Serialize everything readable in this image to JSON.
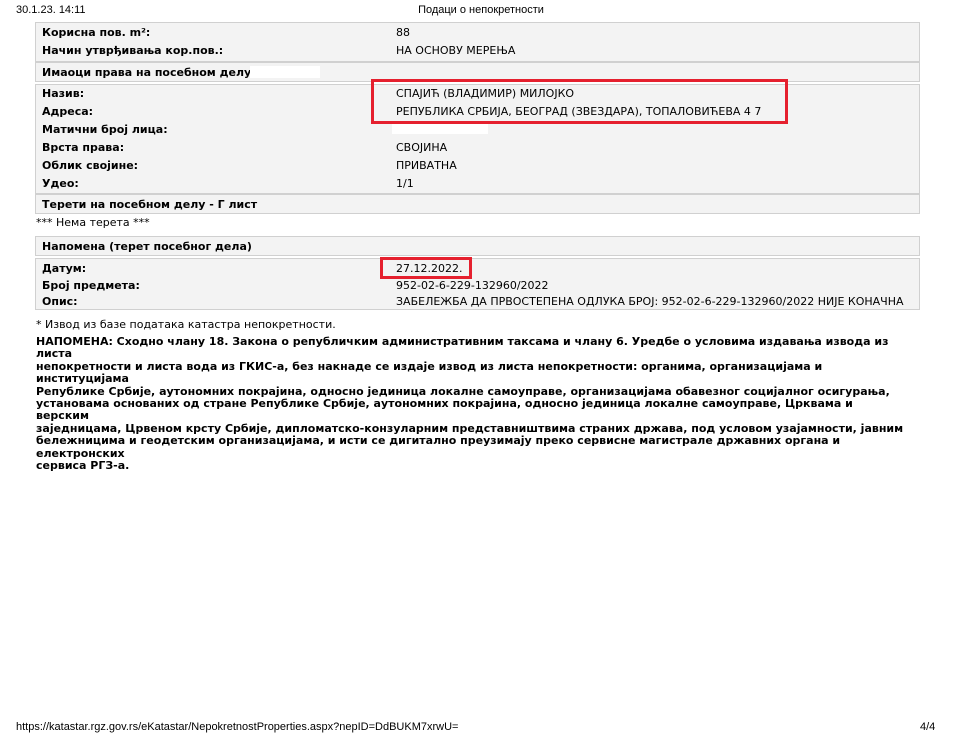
{
  "header": {
    "datetime": "30.1.23. 14:11",
    "title": "Подаци о непокретности"
  },
  "top_rows": [
    {
      "label": "Корисна пов. m²:",
      "value": "88"
    },
    {
      "label": "Начин утврђивања кор.пов.:",
      "value": "НА ОСНОВУ МЕРЕЊА"
    }
  ],
  "owners": {
    "heading": "Имаоци права на посебном делу",
    "rows": [
      {
        "label": "Назив:",
        "value": "СПАЈИЋ (ВЛАДИМИР) МИЛОЈКО"
      },
      {
        "label": "Адреса:",
        "value": "РЕПУБЛИКА СРБИЈА, БЕОГРАД (ЗВЕЗДАРА), ТОПАЛОВИЋЕВА 4 7"
      },
      {
        "label": "Матични број лица:",
        "value": ""
      },
      {
        "label": "Врста права:",
        "value": "СВОЈИНА"
      },
      {
        "label": "Облик својине:",
        "value": "ПРИВАТНА"
      },
      {
        "label": "Удео:",
        "value": "1/1"
      }
    ]
  },
  "burdens": {
    "heading": "Терети на посебном делу - Г лист",
    "text": "*** Нема терета ***"
  },
  "note_section": {
    "heading": "Напомена (терет посебног дела)",
    "rows": [
      {
        "label": "Датум:",
        "value": "27.12.2022."
      },
      {
        "label": "Број предмета:",
        "value": "952-02-6-229-132960/2022"
      },
      {
        "label": "Опис:",
        "value": "ЗАБЕЛЕЖБА ДА ПРВОСТЕПЕНА ОДЛУКА БРОЈ: 952-02-6-229-132960/2022 НИЈЕ КОНАЧНА"
      }
    ]
  },
  "footnote": "* Извод из базе података катастра непокретности.",
  "notice": {
    "lines": [
      "НАПОМЕНА: Сходно члану 18. Закона о републичким административним таксама и члану 6. Уредбе о условима издавања извода из листа",
      "непокретности и листа вода из ГКИС-а, без накнаде се издаје извод из листа непокретности: органима, организацијама и институцијама",
      "Републике Србије, аутономних покрајина, односно јединица локалне самоуправе, организацијама обавезног социјалног осигурања,",
      "установама основаних од стране Републике Србије, аутономних покрајина, односно јединица локалне самоуправе, Црквама и верским",
      "заједницама, Црвеном крсту Србије, дипломатско-конзуларним представништвима страних држава, под условом узајамности, јавним",
      "бележницима и геодетским организацијама, и исти се дигитално преузимају преко сервисне магистрале државних органа и електронских",
      "сервиса РГЗ-а."
    ]
  },
  "footer": {
    "url": "https://katastar.rgz.gov.rs/eKatastar/NepokretnostProperties.aspx?nepID=DdBUKM7xrwU=",
    "page": "4/4"
  },
  "colors": {
    "highlight_box": "#e5202e",
    "panel_bg": "#f3f3f3"
  }
}
